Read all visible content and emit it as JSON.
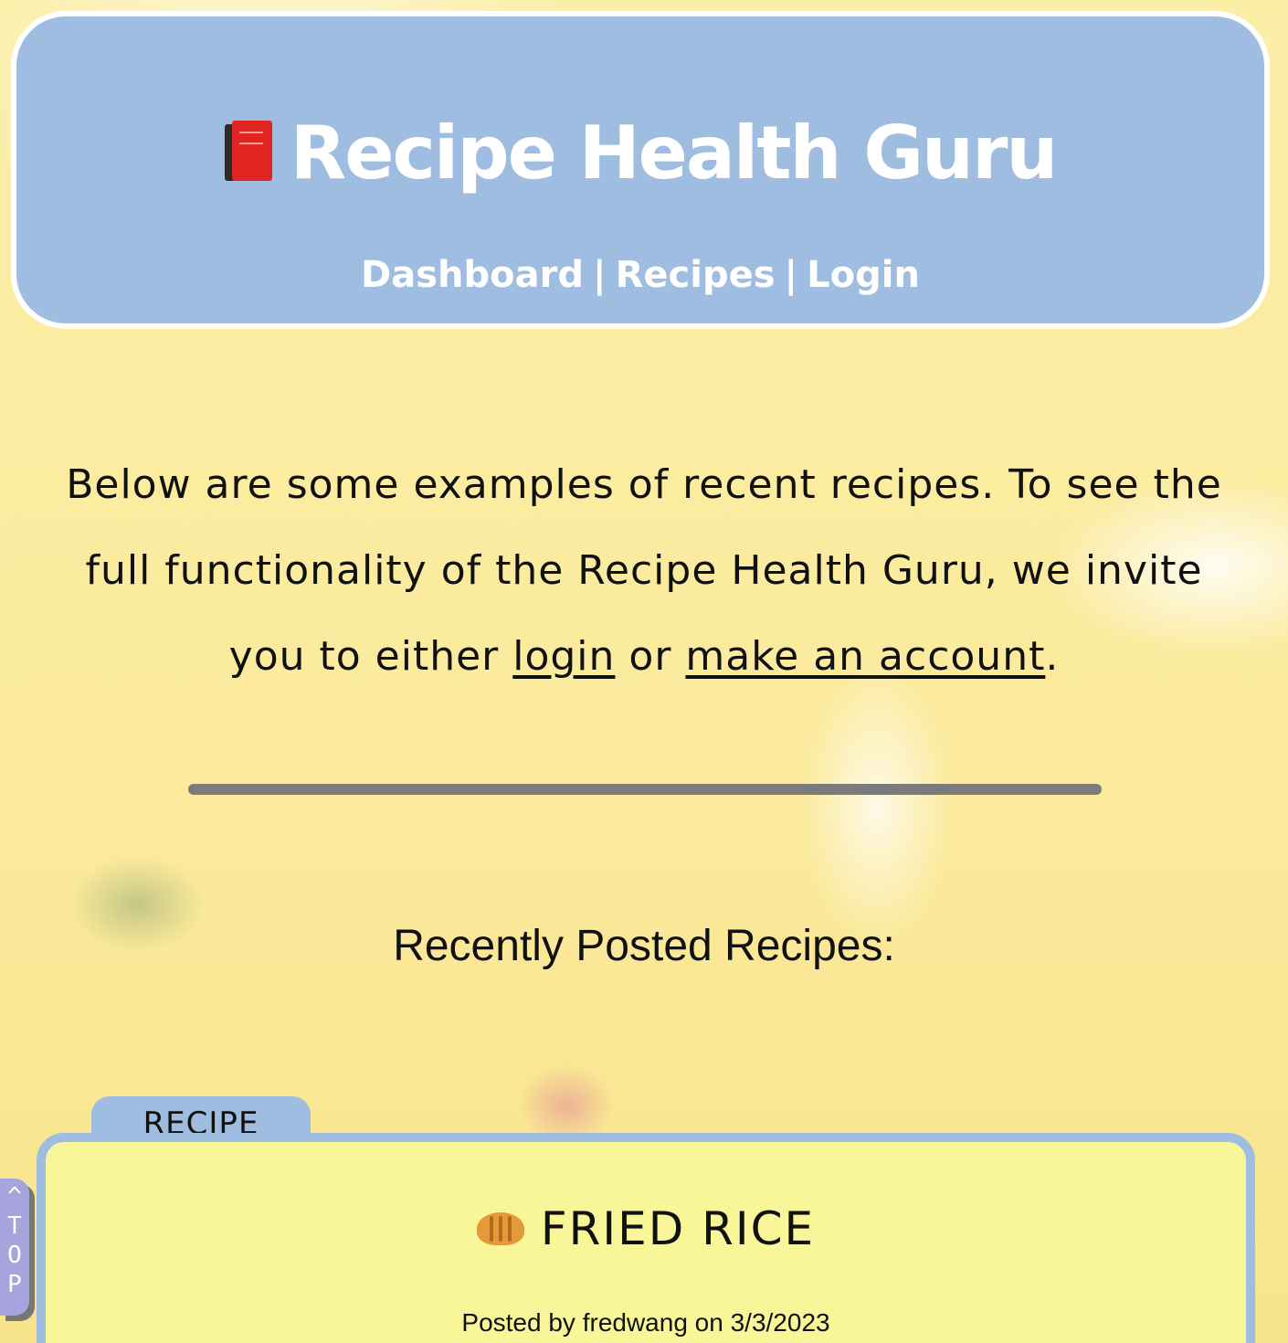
{
  "header": {
    "icon": "book-icon",
    "title": "Recipe Health Guru",
    "nav": {
      "dashboard": "Dashboard",
      "recipes": "Recipes",
      "login": "Login",
      "separator": "|"
    }
  },
  "intro": {
    "text_before": "Below are some examples of recent recipes. To see the full functionality of the Recipe Health Guru, we invite you to either ",
    "login_link": "login",
    "text_middle": " or ",
    "account_link": "make an account",
    "text_after": "."
  },
  "recent": {
    "heading": "Recently Posted Recipes:"
  },
  "recipe_card": {
    "tab_label": "RECIPE",
    "icon": "croissant-icon",
    "title": "FRIED RICE",
    "posted_by": "Posted by fredwang on 3/3/2023"
  },
  "top_button": {
    "label": "^\nT\nO\nP"
  },
  "colors": {
    "header_bg": "#9fbde0",
    "page_bg": "#fbeea7",
    "card_bg": "#f9f69a",
    "top_button_bg": "#a6a3dd"
  }
}
